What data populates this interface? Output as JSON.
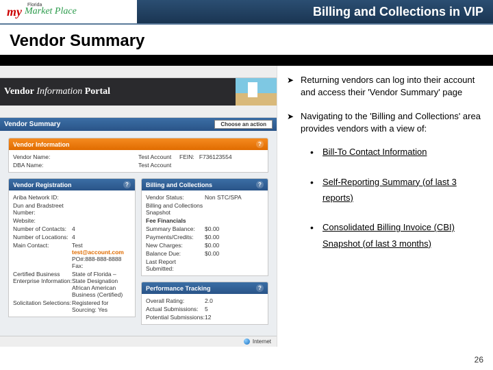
{
  "header": {
    "logo_my": "my",
    "logo_florida": "Florida",
    "logo_market": "Market Place",
    "title": "Billing and Collections in VIP"
  },
  "section_title": "Vendor Summary",
  "screenshot": {
    "banner_part1": "Vendor",
    "banner_part2": "Information",
    "banner_part3": "Portal",
    "vs_label": "Vendor Summary",
    "choose_action": "Choose an action",
    "vendor_info_title": "Vendor Information",
    "vendor_name_k": "Vendor Name:",
    "vendor_name_v": "Test Account",
    "fein_k": "FEIN:",
    "fein_v": "F736123554",
    "dba_k": "DBA Name:",
    "dba_v": "Test Account",
    "reg_title": "Vendor Registration",
    "ariba_k": "Ariba Network ID:",
    "dnb_k": "Dun and Bradstreet Number:",
    "website_k": "Website:",
    "contacts_k": "Number of Contacts:",
    "contacts_v": "4",
    "locations_k": "Number of Locations:",
    "locations_v": "4",
    "main_contact_k": "Main Contact:",
    "main_contact_name": "Test",
    "main_contact_email": "test@account.com",
    "main_contact_phone": "PO#:888-888-8888",
    "main_contact_fax": "Fax:",
    "cbe_k": "Certified Business Enterprise Information:",
    "cbe_v": "State of Florida – State Designation African American Business (Certified)",
    "sol_k": "Solicitation Selections:",
    "sol_v": "Registered for Sourcing: Yes",
    "bc_title": "Billing and Collections",
    "vstatus_k": "Vendor Status:",
    "vstatus_v": "Non STC/SPA",
    "bcs_k": "Billing and Collections Snapshot",
    "fee_link": "Fee Financials",
    "sum_bal_k": "Summary Balance:",
    "sum_bal_v": "$0.00",
    "pay_k": "Payments/Credits:",
    "pay_v": "$0.00",
    "new_k": "New Charges:",
    "new_v": "$0.00",
    "bal_k": "Balance Due:",
    "bal_v": "$0.00",
    "last_k": "Last Report Submitted:",
    "perf_title": "Performance Tracking",
    "overall_k": "Overall Rating:",
    "overall_v": "2.0",
    "actual_k": "Actual Submissions:",
    "actual_v": "5",
    "potential_k": "Potential Submissions:",
    "potential_v": "12",
    "status_internet": "Internet"
  },
  "bullets": {
    "b1": "Returning vendors can log into their account and access their 'Vendor Summary' page",
    "b2": "Navigating to the 'Billing and Collections' area provides vendors with a view of:",
    "s1": "Bill-To Contact Information",
    "s2a": "Self-Reporting Summary (of last 3",
    "s2b": "reports)",
    "s3a": "Consolidated Billing Invoice (CBI)",
    "s3b": "Snapshot (of last 3 months)"
  },
  "page_number": "26"
}
